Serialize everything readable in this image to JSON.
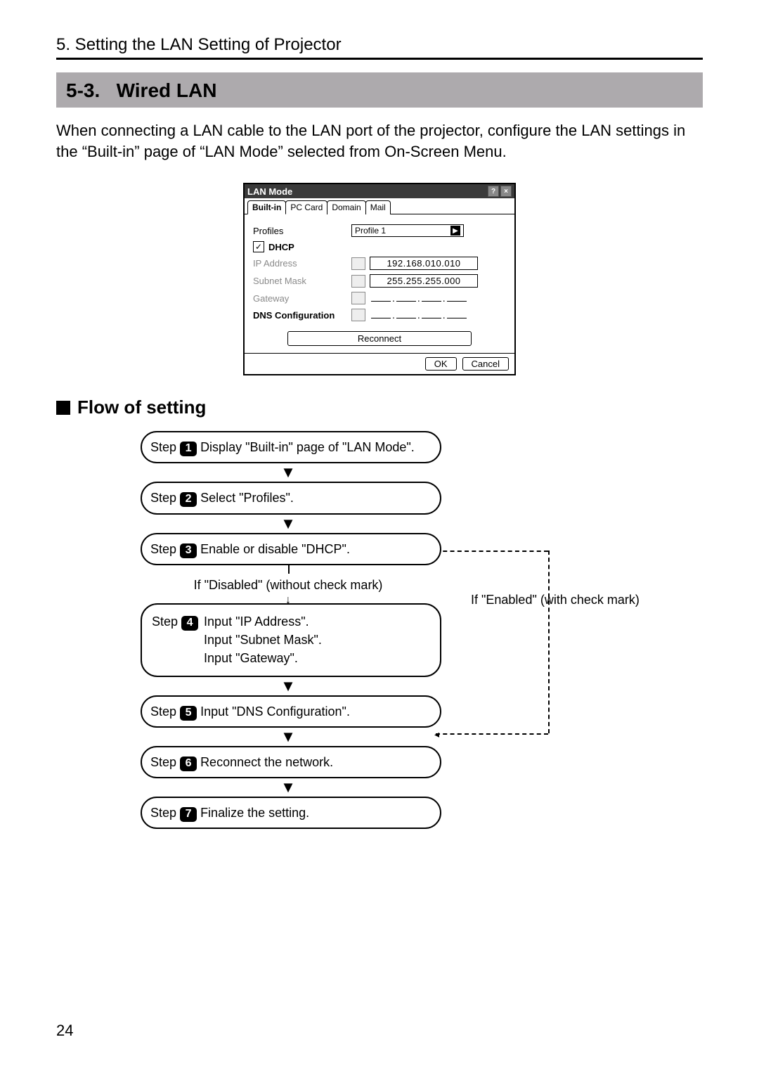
{
  "chapter_head": "5. Setting the LAN Setting of Projector",
  "section_number": "5-3.",
  "section_title": "Wired LAN",
  "intro": "When connecting a LAN cable to the LAN port of the projector, configure the LAN settings in the “Built-in” page of “LAN Mode” selected from On-Screen Menu.",
  "dialog": {
    "title": "LAN Mode",
    "tabs": [
      "Built-in",
      "PC Card",
      "Domain",
      "Mail"
    ],
    "active_tab": 0,
    "profiles_label": "Profiles",
    "profiles_value": "Profile 1",
    "dhcp_label": "DHCP",
    "ip_label": "IP Address",
    "ip_value": "192.168.010.010",
    "subnet_label": "Subnet Mask",
    "subnet_value": "255.255.255.000",
    "gateway_label": "Gateway",
    "dns_label": "DNS Configuration",
    "reconnect": "Reconnect",
    "ok": "OK",
    "cancel": "Cancel"
  },
  "flow_heading": "Flow of setting",
  "steps": {
    "s1": "Display \"Built-in\" page of \"LAN Mode\".",
    "s2": "Select \"Profiles\".",
    "s3": "Enable or disable \"DHCP\".",
    "branch_disabled": "If \"Disabled\" (without check mark)",
    "branch_enabled": "If \"Enabled\" (with check mark)",
    "s4a": "Input \"IP Address\".",
    "s4b": "Input \"Subnet Mask\".",
    "s4c": "Input \"Gateway\".",
    "s5": "Input \"DNS Configuration\".",
    "s6": "Reconnect the network.",
    "s7": "Finalize the setting.",
    "step_word": "Step"
  },
  "page_number": "24"
}
